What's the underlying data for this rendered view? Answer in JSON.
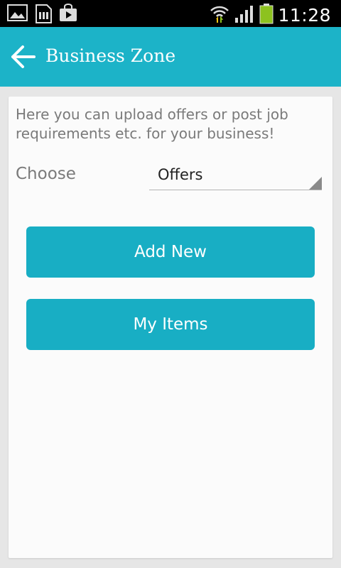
{
  "status_bar": {
    "time": "11:28",
    "left_icons": [
      "gallery-icon",
      "sd-card-icon",
      "store-bag-icon"
    ],
    "right_icons": [
      "wifi-icon",
      "signal-icon",
      "battery-icon"
    ]
  },
  "app_bar": {
    "title": "Business Zone",
    "back_icon": "arrow-left-icon"
  },
  "content": {
    "intro": "Here you can upload offers or post job requirements etc. for your business!",
    "choose_label": "Choose",
    "selected_option": "Offers",
    "add_new_label": "Add New",
    "my_items_label": "My Items"
  },
  "colors": {
    "accent": "#1cb3c8",
    "button": "#18aec4",
    "battery": "#8dc21f"
  }
}
